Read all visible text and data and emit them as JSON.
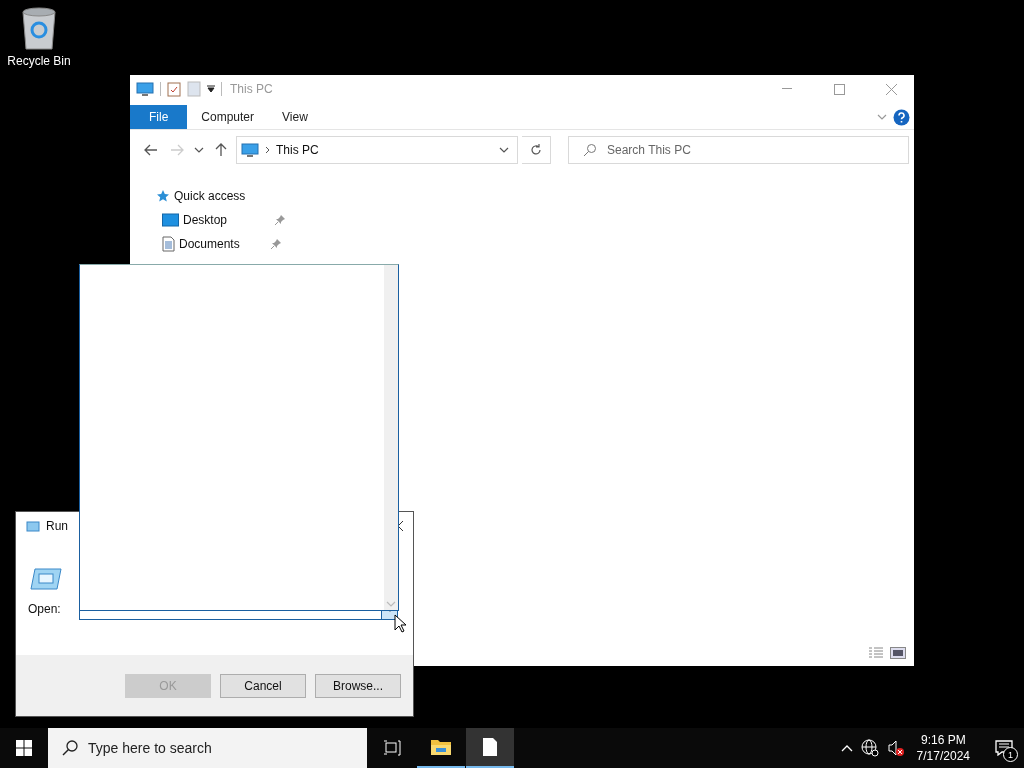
{
  "desktop_icons": [
    {
      "label": "Recycle Bin"
    }
  ],
  "explorer": {
    "title": "This PC",
    "ribbon_tabs": [
      {
        "label": "File",
        "kind": "menu"
      },
      {
        "label": "Computer",
        "kind": "tab"
      },
      {
        "label": "View",
        "kind": "tab"
      }
    ],
    "address": "This PC",
    "search": {
      "placeholder": "Search This PC"
    },
    "nav": [
      {
        "label": "Quick access",
        "kind": "star",
        "children": [
          {
            "label": "Desktop",
            "kind": "desktop",
            "pinned": true
          },
          {
            "label": "Documents",
            "kind": "document",
            "pinned": true
          }
        ]
      }
    ]
  },
  "run": {
    "title": "Run",
    "open_label": "Open:",
    "dropdown_expanded": true,
    "buttons": [
      {
        "label": "OK",
        "disabled": true
      },
      {
        "label": "Cancel",
        "disabled": false
      },
      {
        "label": "Browse...",
        "disabled": false
      }
    ]
  },
  "taskbar": {
    "search": {
      "placeholder": "Type here to search"
    },
    "apps": [
      {
        "kind": "folder",
        "selected": false
      },
      {
        "kind": "file",
        "selected": true
      }
    ],
    "time": "9:16 PM",
    "date": "7/17/2024",
    "notifications": "1"
  }
}
